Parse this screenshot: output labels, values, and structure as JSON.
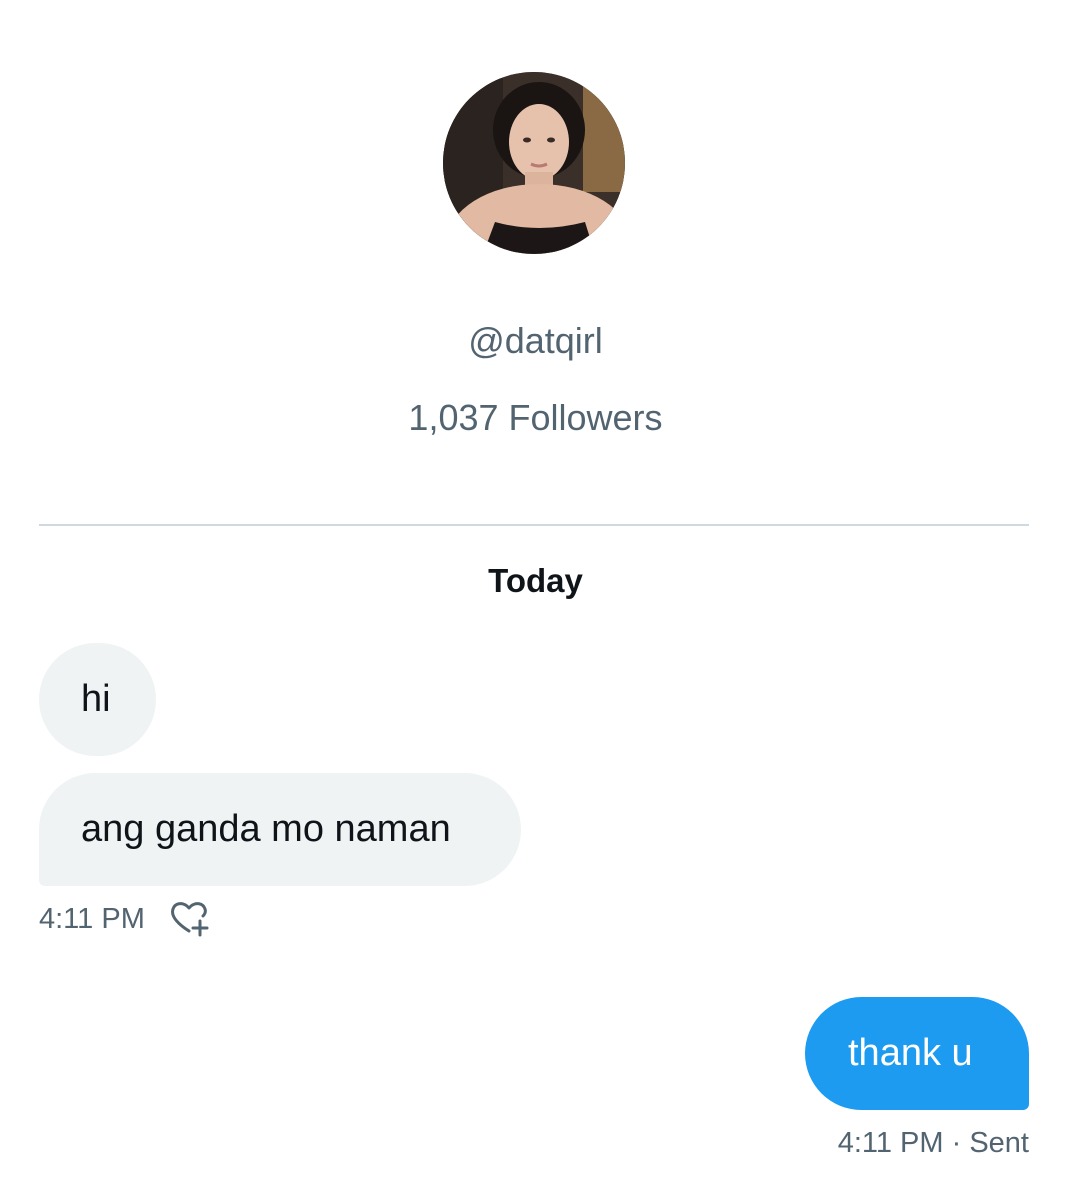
{
  "profile": {
    "handle": "@datqirl",
    "followers": "1,037 Followers"
  },
  "conversation": {
    "day_label": "Today",
    "incoming": [
      {
        "text": "hi"
      },
      {
        "text": "ang ganda mo naman"
      }
    ],
    "incoming_time": "4:11 PM",
    "react_icon": "heart-plus-icon",
    "outgoing": [
      {
        "text": "thank u"
      }
    ],
    "outgoing_time": "4:11 PM",
    "outgoing_status_sep": " · ",
    "outgoing_status": "Sent"
  },
  "colors": {
    "accent": "#1d9bf0",
    "secondary_text": "#536471",
    "incoming_bubble": "#eff3f4",
    "divider": "#cfd9de"
  }
}
